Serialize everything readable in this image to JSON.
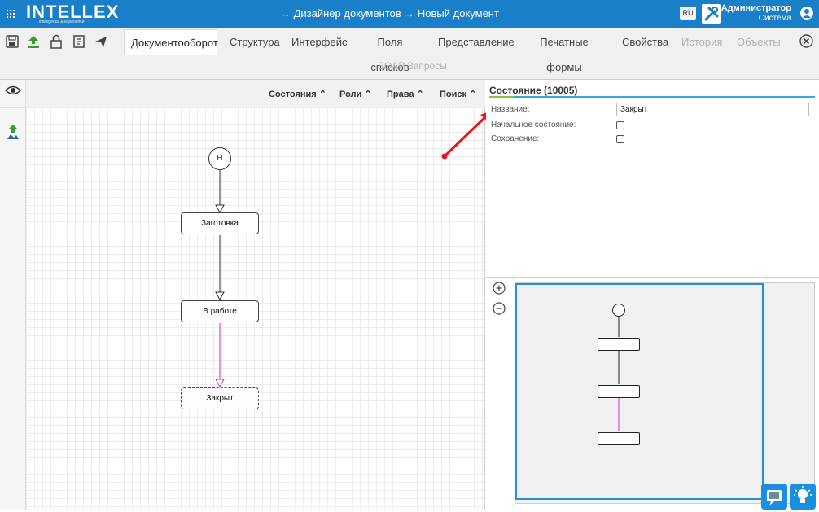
{
  "header": {
    "logo": "INTELLEX",
    "logo_sub": "intelligence & experience",
    "breadcrumb": "→  Дизайнер документов  →  Новый документ",
    "lang": "RU",
    "user_name": "Администратор",
    "user_role": "Система"
  },
  "toolbar": {
    "icons": [
      "save-icon",
      "upload-icon",
      "lock-icon",
      "document-icon",
      "send-icon"
    ],
    "tabs": [
      {
        "label": "Документооборот",
        "state": "active"
      },
      {
        "label": "Структура",
        "state": "normal"
      },
      {
        "label": "Интерфейс",
        "state": "normal"
      },
      {
        "label": "Поля списков",
        "state": "normal"
      },
      {
        "label": "Представление",
        "state": "normal"
      },
      {
        "label": "Печатные формы",
        "state": "normal"
      },
      {
        "label": "Свойства",
        "state": "normal"
      },
      {
        "label": "История",
        "state": "disabled"
      },
      {
        "label": "Объекты",
        "state": "disabled"
      }
    ],
    "second_row_tab": "SOAP Запросы"
  },
  "canvas_header": {
    "items": [
      "Состояния",
      "Роли",
      "Права",
      "Поиск"
    ]
  },
  "diagram": {
    "start_label": "Н",
    "nodes": [
      "Заготовка",
      "В работе",
      "Закрыт"
    ],
    "selected_node": "Закрыт",
    "transition_colors": [
      "#333333",
      "#333333",
      "#cc33cc"
    ]
  },
  "properties": {
    "title": "Состояние (10005)",
    "fields": {
      "name_label": "Название:",
      "name_value": "Закрыт",
      "initial_label": "Начальное состояние:",
      "initial_checked": false,
      "save_label": "Сохранение:",
      "save_checked": false
    }
  },
  "colors": {
    "brand": "#1a7fc9",
    "accent_bar": "#33aadd",
    "accent_green": "#8cc63f",
    "annotation_arrow": "#e8141a",
    "minimap_border": "#1e90e0"
  }
}
